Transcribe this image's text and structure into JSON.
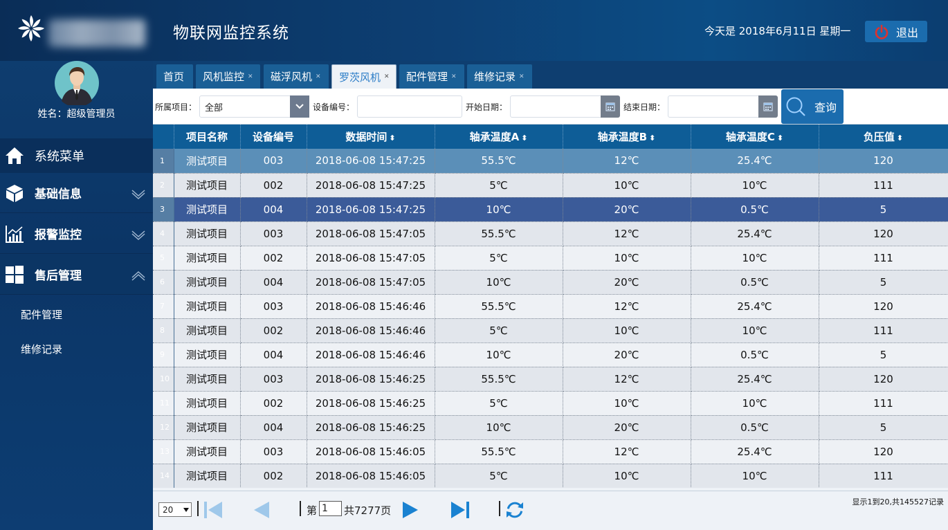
{
  "header": {
    "title": "物联网监控系统",
    "date_text": "今天是 2018年6月11日 星期一",
    "logout_label": "退出"
  },
  "user": {
    "name_label": "姓名：超级管理员"
  },
  "menu": {
    "header_label": "系统菜单",
    "groups": [
      {
        "label": "基础信息",
        "icon": "cube-icon",
        "expanded": false
      },
      {
        "label": "报警监控",
        "icon": "chart-icon",
        "expanded": false
      },
      {
        "label": "售后管理",
        "icon": "windows-icon",
        "expanded": true
      }
    ],
    "sub_items": [
      "配件管理",
      "维修记录"
    ]
  },
  "tabs": [
    {
      "label": "首页",
      "closable": false,
      "active": false
    },
    {
      "label": "风机监控",
      "closable": true,
      "active": false
    },
    {
      "label": "磁浮风机",
      "closable": true,
      "active": false
    },
    {
      "label": "罗茨风机",
      "closable": true,
      "active": true
    },
    {
      "label": "配件管理",
      "closable": true,
      "active": false
    },
    {
      "label": "维修记录",
      "closable": true,
      "active": false
    }
  ],
  "search": {
    "project_label": "所属项目：",
    "project_value": "全部",
    "device_label": "设备编号：",
    "device_value": "",
    "start_label": "开始日期：",
    "start_value": "",
    "end_label": "结束日期：",
    "end_value": "",
    "query_label": "查询"
  },
  "table": {
    "columns": [
      "项目名称",
      "设备编号",
      "数据时间",
      "轴承温度A",
      "轴承温度B",
      "轴承温度C",
      "负压值"
    ],
    "sortable": [
      false,
      false,
      true,
      true,
      true,
      true,
      true
    ],
    "rows": [
      [
        "1",
        "测试项目",
        "003",
        "2018-06-08 15:47:25",
        "55.5℃",
        "12℃",
        "25.4℃",
        "120"
      ],
      [
        "2",
        "测试项目",
        "002",
        "2018-06-08 15:47:25",
        "5℃",
        "10℃",
        "10℃",
        "111"
      ],
      [
        "3",
        "测试项目",
        "004",
        "2018-06-08 15:47:25",
        "10℃",
        "20℃",
        "0.5℃",
        "5"
      ],
      [
        "4",
        "测试项目",
        "003",
        "2018-06-08 15:47:05",
        "55.5℃",
        "12℃",
        "25.4℃",
        "120"
      ],
      [
        "5",
        "测试项目",
        "002",
        "2018-06-08 15:47:05",
        "5℃",
        "10℃",
        "10℃",
        "111"
      ],
      [
        "6",
        "测试项目",
        "004",
        "2018-06-08 15:47:05",
        "10℃",
        "20℃",
        "0.5℃",
        "5"
      ],
      [
        "7",
        "测试项目",
        "003",
        "2018-06-08 15:46:46",
        "55.5℃",
        "12℃",
        "25.4℃",
        "120"
      ],
      [
        "8",
        "测试项目",
        "002",
        "2018-06-08 15:46:46",
        "5℃",
        "10℃",
        "10℃",
        "111"
      ],
      [
        "9",
        "测试项目",
        "004",
        "2018-06-08 15:46:46",
        "10℃",
        "20℃",
        "0.5℃",
        "5"
      ],
      [
        "10",
        "测试项目",
        "003",
        "2018-06-08 15:46:25",
        "55.5℃",
        "12℃",
        "25.4℃",
        "120"
      ],
      [
        "11",
        "测试项目",
        "002",
        "2018-06-08 15:46:25",
        "5℃",
        "10℃",
        "10℃",
        "111"
      ],
      [
        "12",
        "测试项目",
        "004",
        "2018-06-08 15:46:25",
        "10℃",
        "20℃",
        "0.5℃",
        "5"
      ],
      [
        "13",
        "测试项目",
        "003",
        "2018-06-08 15:46:05",
        "55.5℃",
        "12℃",
        "25.4℃",
        "120"
      ],
      [
        "14",
        "测试项目",
        "002",
        "2018-06-08 15:46:05",
        "5℃",
        "10℃",
        "10℃",
        "111"
      ]
    ],
    "hover_row": 1,
    "selected_row": 3
  },
  "pager": {
    "page_size": "20",
    "page_prefix": "第",
    "page_current": "1",
    "page_suffix": "共7277页",
    "records_info": "显示1到20,共145527记录"
  },
  "colors": {
    "header_bg": "#0d3f73",
    "accent": "#1b6cae",
    "table_header": "#0e5d97",
    "selected_row": "#3b5b99",
    "hover_row": "#5b8fb8",
    "logout_icon": "#e0312b"
  }
}
